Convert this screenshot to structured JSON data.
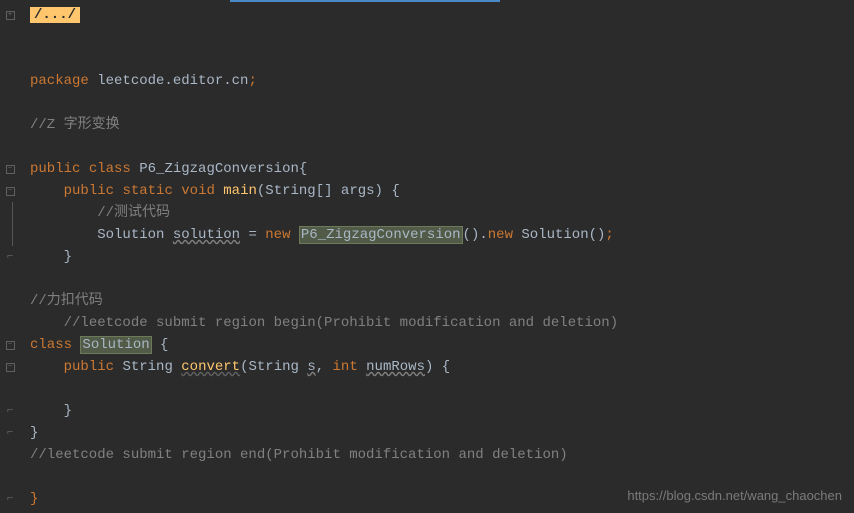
{
  "fold_marker": "/.../",
  "lines": {
    "package": {
      "kw": "package",
      "name": "leetcode.editor.cn"
    },
    "comment_title": "//Z 字形变换",
    "class_decl": {
      "kw1": "public",
      "kw2": "class",
      "name": "P6_ZigzagConversion"
    },
    "main_decl": {
      "kw1": "public",
      "kw2": "static",
      "kw3": "void",
      "method": "main",
      "param_type": "String[]",
      "param_name": "args"
    },
    "comment_test": "//测试代码",
    "solution_line": {
      "type": "Solution",
      "var": "solution",
      "eq": "=",
      "kw_new1": "new",
      "ctor": "P6_ZigzagConversion",
      "dot_new": ".",
      "kw_new2": "new",
      "inner": "Solution"
    },
    "comment_leetcode_cn": "//力扣代码",
    "comment_region_begin": "//leetcode submit region begin(Prohibit modification and deletion)",
    "inner_class": {
      "kw": "class",
      "name": "Solution"
    },
    "convert_decl": {
      "kw1": "public",
      "ret": "String",
      "method": "convert",
      "p1type": "String",
      "p1": "s",
      "p2type": "int",
      "p2": "numRows"
    },
    "comment_region_end": "//leetcode submit region end(Prohibit modification and deletion)"
  },
  "watermark": "https://blog.csdn.net/wang_chaochen"
}
